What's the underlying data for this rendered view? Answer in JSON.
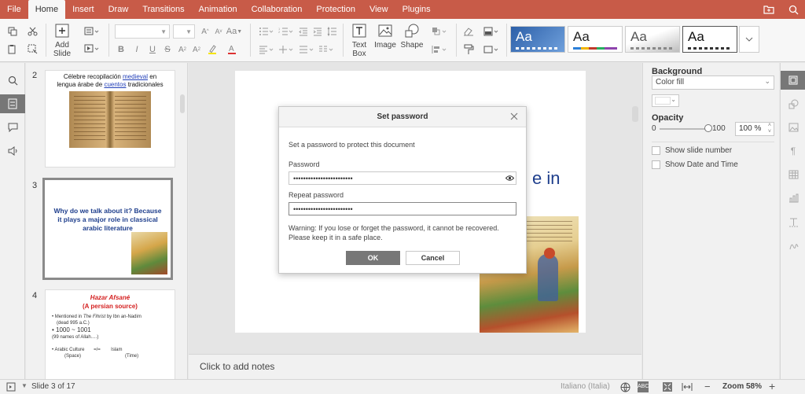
{
  "menubar": {
    "tabs": [
      "File",
      "Home",
      "Insert",
      "Draw",
      "Transitions",
      "Animation",
      "Collaboration",
      "Protection",
      "View",
      "Plugins"
    ],
    "active_tab": "Home"
  },
  "toolbar": {
    "add_slide_label": "Add Slide",
    "textbox_label": "Text Box",
    "image_label": "Image",
    "shape_label": "Shape",
    "theme_label": "Aa"
  },
  "thumbnails": [
    {
      "number": "2",
      "line1_pre": "Célebre recopilación ",
      "line1_link": "medieval",
      "line1_post": " en",
      "line2_pre": "lengua árabe de ",
      "line2_link": "cuentos",
      "line2_post": " tradicionales"
    },
    {
      "number": "3",
      "title": "Why do we talk about it? Because it plays a major role in classical arabic literature"
    },
    {
      "number": "4",
      "title1": "Hazar Afsané",
      "title2": "(A persian source)",
      "b1_pre": "Mentioned in ",
      "b1_em": "The Fihrist",
      "b1_post": " by Ibn an-Nadim",
      "b1_sub": "(dead 995 a.C.)",
      "b2": "1000 ~ 1001",
      "b2_sub": "(99 names of Allah….)",
      "b3": "Arabic Culture",
      "b3_eq": "=/=",
      "b3_right": "Islam",
      "b3_left_sub": "(Space)",
      "b3_right_sub": "(Time)"
    }
  ],
  "slide": {
    "visible_text": "e in"
  },
  "notes": {
    "placeholder": "Click to add notes"
  },
  "right_panel": {
    "background_label": "Background",
    "fill_value": "Color fill",
    "opacity_label": "Opacity",
    "opacity_min": "0",
    "opacity_max": "100",
    "opacity_value": "100 %",
    "show_slide_number": "Show slide number",
    "show_date_time": "Show Date and Time"
  },
  "statusbar": {
    "slide_info": "Slide 3 of 17",
    "language": "Italiano (Italia)",
    "zoom": "Zoom 58%"
  },
  "dialog": {
    "title": "Set password",
    "description": "Set a password to protect this document",
    "password_label": "Password",
    "password_value": "••••••••••••••••••••••••",
    "repeat_label": "Repeat password",
    "repeat_value": "••••••••••••••••••••••••",
    "warning": "Warning: If you lose or forget the password, it cannot be recovered. Please keep it in a safe place.",
    "ok_label": "OK",
    "cancel_label": "Cancel"
  }
}
